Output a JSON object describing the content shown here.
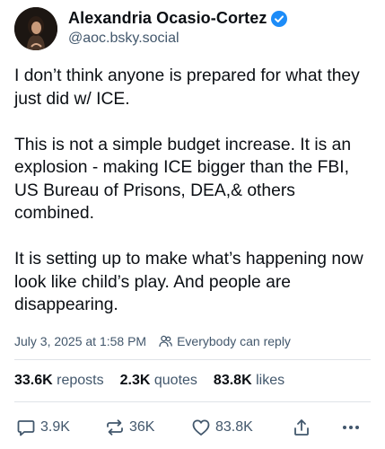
{
  "author": {
    "display_name": "Alexandria Ocasio-Cortez",
    "handle": "@aoc.bsky.social",
    "verified": true
  },
  "post": {
    "paragraphs": [
      "I don’t think anyone is prepared for what they just did w/ ICE.",
      "This is not a simple budget increase. It is an explosion - making ICE bigger than the FBI, US Bureau of Prisons, DEA,& others combined.",
      "It is setting up to make what’s happening now look like child’s play. And people are disappearing."
    ],
    "timestamp": "July 3, 2025 at 1:58 PM",
    "reply_setting": "Everybody can reply"
  },
  "stats": {
    "reposts_count": "33.6K",
    "reposts_label": "reposts",
    "quotes_count": "2.3K",
    "quotes_label": "quotes",
    "likes_count": "83.8K",
    "likes_label": "likes"
  },
  "actions": {
    "reply_count": "3.9K",
    "repost_count": "36K",
    "like_count": "83.8K"
  },
  "colors": {
    "verified_badge": "#1d8cf8",
    "muted_text": "#42576c"
  }
}
